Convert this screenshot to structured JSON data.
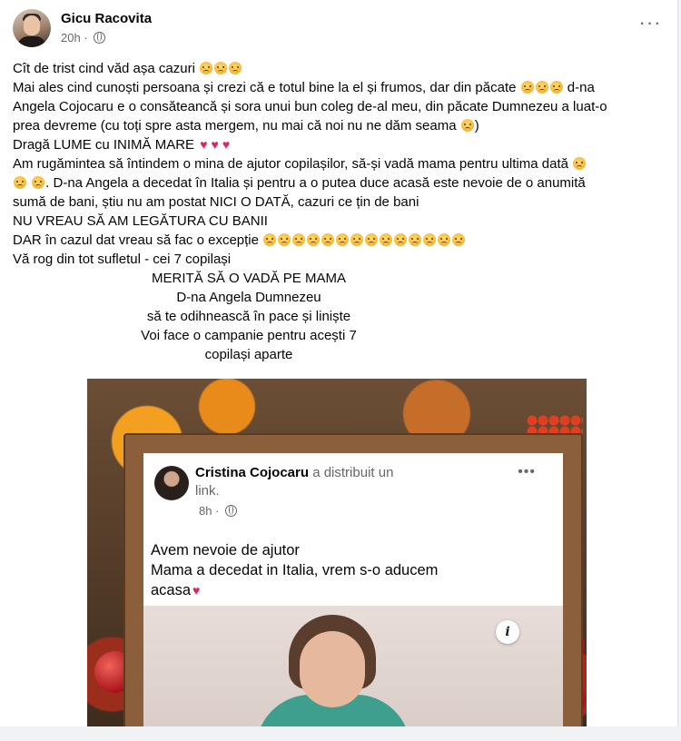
{
  "post": {
    "author": "Gicu Racovita",
    "time": "20h",
    "privacy_icon": "globe-icon",
    "menu_icon": "more-horizontal-icon",
    "lines": [
      "Cît de trist cind văd așa cazuri",
      "Mai ales cind cunoști persoana și crezi că e totul bine la el și frumos, dar din păcate",
      "d-na",
      "Angela Cojocaru e o consăteancă și sora unui bun coleg de-al meu, din păcate Dumnezeu a luat-o",
      "prea devreme (cu toți spre asta mergem, nu mai că noi nu ne dăm seama",
      ")",
      "Dragă LUME cu INIMĂ MARE",
      "Am rugămintea să întindem o mina de ajutor copilașilor, să-și vadă mama pentru ultima dată",
      ". D-na Angela a decedat în Italia și pentru a o putea duce acasă este nevoie de o anumită",
      "sumă de bani, știu nu am postat NICI O DATĂ, cazuri ce țin de bani",
      "NU VREAU SĂ AM LEGĂTURA CU BANII",
      "DAR în cazul dat vreau să fac o excepție",
      "Vă rog din tot sufletul - cei 7 copilași",
      "MERITĂ SĂ O VADĂ PE MAMA",
      "D-na Angela Dumnezeu",
      "să te odihnească în pace și liniște",
      "Voi face o campanie pentru acești 7",
      "copilași aparte"
    ]
  },
  "shared": {
    "author": "Cristina Cojocaru",
    "action": "a distribuit un",
    "action2": "link.",
    "time": "8h",
    "text1": "Avem nevoie de ajutor",
    "text2": "Mama a decedat in Italia, vrem s-o aducem",
    "text3": "acasa",
    "info_icon": "info-icon",
    "info_label": "i"
  },
  "colors": {
    "text": "#050505",
    "meta": "#65676b",
    "frame": "#8b5e3c"
  }
}
